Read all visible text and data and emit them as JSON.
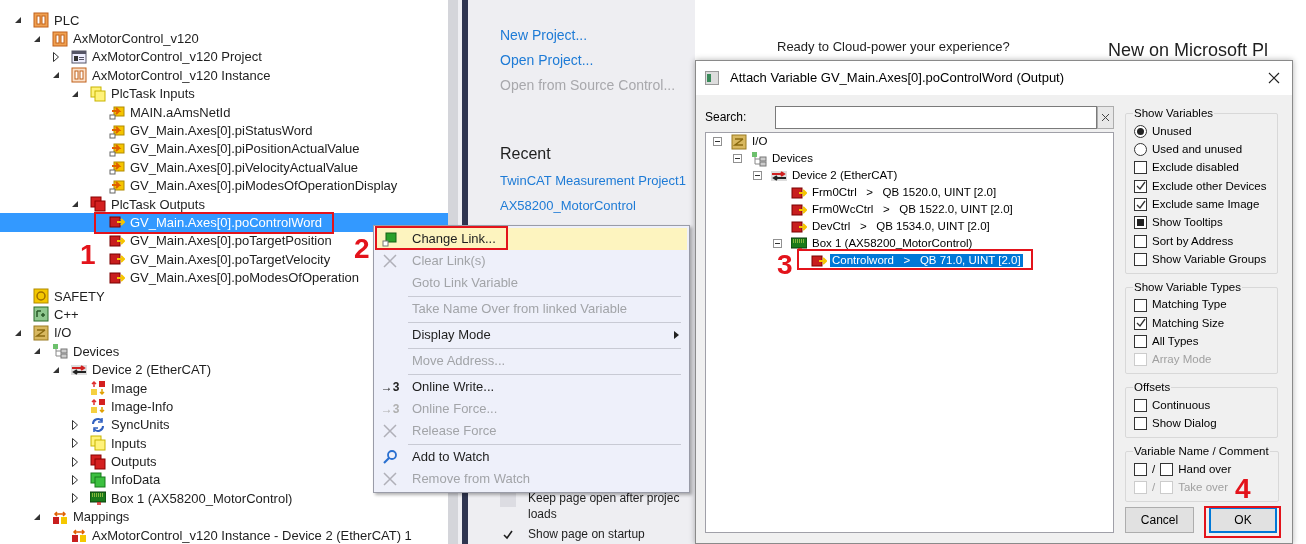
{
  "left_tree": {
    "items": [
      {
        "label": "PLC",
        "kind": "plc",
        "expanded": true,
        "selected": false,
        "children": [
          {
            "label": "AxMotorControl_v120",
            "kind": "plc",
            "expanded": true,
            "selected": false,
            "children": [
              {
                "label": "AxMotorControl_v120 Project",
                "kind": "project",
                "expanded": false,
                "selected": false
              },
              {
                "label": "AxMotorControl_v120 Instance",
                "kind": "instance",
                "expanded": true,
                "selected": false,
                "children": [
                  {
                    "label": "PlcTask Inputs",
                    "kind": "inputs",
                    "expanded": true,
                    "selected": false,
                    "children": [
                      {
                        "label": "MAIN.aAmsNetId",
                        "kind": "input-var",
                        "selected": false
                      },
                      {
                        "label": "GV_Main.Axes[0].piStatusWord",
                        "kind": "input-var",
                        "selected": false
                      },
                      {
                        "label": "GV_Main.Axes[0].piPositionActualValue",
                        "kind": "input-var",
                        "selected": false
                      },
                      {
                        "label": "GV_Main.Axes[0].piVelocityActualValue",
                        "kind": "input-var",
                        "selected": false
                      },
                      {
                        "label": "GV_Main.Axes[0].piModesOfOperationDisplay",
                        "kind": "input-var",
                        "selected": false
                      }
                    ]
                  },
                  {
                    "label": "PlcTask Outputs",
                    "kind": "outputs",
                    "expanded": true,
                    "selected": false,
                    "children": [
                      {
                        "label": "GV_Main.Axes[0].poControlWord",
                        "kind": "output-var",
                        "selected": true
                      },
                      {
                        "label": "GV_Main.Axes[0].poTargetPosition",
                        "kind": "output-var",
                        "selected": false
                      },
                      {
                        "label": "GV_Main.Axes[0].poTargetVelocity",
                        "kind": "output-var",
                        "selected": false
                      },
                      {
                        "label": "GV_Main.Axes[0].poModesOfOperation",
                        "kind": "output-var",
                        "selected": false
                      }
                    ]
                  }
                ]
              }
            ]
          }
        ]
      },
      {
        "label": "SAFETY",
        "kind": "safety",
        "selected": false
      },
      {
        "label": "C++",
        "kind": "cpp",
        "selected": false
      },
      {
        "label": "I/O",
        "kind": "io",
        "expanded": true,
        "selected": false,
        "children": [
          {
            "label": "Devices",
            "kind": "devices",
            "expanded": true,
            "selected": false,
            "children": [
              {
                "label": "Device 2 (EtherCAT)",
                "kind": "ethercat",
                "expanded": true,
                "selected": false,
                "children": [
                  {
                    "label": "Image",
                    "kind": "image",
                    "selected": false
                  },
                  {
                    "label": "Image-Info",
                    "kind": "image",
                    "selected": false
                  },
                  {
                    "label": "SyncUnits",
                    "kind": "sync",
                    "expanded": false,
                    "selected": false
                  },
                  {
                    "label": "Inputs",
                    "kind": "inputs",
                    "expanded": false,
                    "selected": false
                  },
                  {
                    "label": "Outputs",
                    "kind": "outputs",
                    "expanded": false,
                    "selected": false
                  },
                  {
                    "label": "InfoData",
                    "kind": "infodata",
                    "expanded": false,
                    "selected": false
                  },
                  {
                    "label": "Box 1 (AX58200_MotorControl)",
                    "kind": "box",
                    "expanded": false,
                    "selected": false
                  }
                ]
              }
            ]
          },
          {
            "label": "Mappings",
            "kind": "mappings",
            "expanded": true,
            "selected": false,
            "children": [
              {
                "label": "AxMotorControl_v120 Instance - Device 2 (EtherCAT) 1",
                "kind": "mapping",
                "selected": false
              }
            ]
          }
        ]
      }
    ]
  },
  "start_page": {
    "links": [
      {
        "text": "New Project...",
        "disabled": false
      },
      {
        "text": "Open Project...",
        "disabled": false
      },
      {
        "text": "Open from Source Control...",
        "disabled": true
      }
    ],
    "recent_heading": "Recent",
    "recent": [
      "TwinCAT Measurement Project1",
      "AX58200_MotorControl"
    ],
    "options": [
      {
        "label": "Keep page open after projec loads",
        "checked": false
      },
      {
        "label": "Show page on startup",
        "checked": true
      }
    ],
    "promo": "Ready to Cloud-power your experience?",
    "news_heading": "New on Microsoft Pl"
  },
  "context_menu": {
    "items": [
      {
        "kind": "link",
        "label": "Change Link...",
        "disabled": false,
        "selected": true,
        "submenu": false
      },
      {
        "kind": "clear",
        "label": "Clear Link(s)",
        "disabled": true,
        "selected": false,
        "submenu": false
      },
      {
        "kind": "plain",
        "label": "Goto Link Variable",
        "disabled": true,
        "selected": false,
        "submenu": false
      },
      {
        "kind": "separator"
      },
      {
        "kind": "plain",
        "label": "Take Name Over from linked Variable",
        "disabled": true,
        "selected": false,
        "submenu": false
      },
      {
        "kind": "separator"
      },
      {
        "kind": "plain",
        "label": "Display Mode",
        "disabled": false,
        "selected": false,
        "submenu": true
      },
      {
        "kind": "separator"
      },
      {
        "kind": "plain",
        "label": "Move Address...",
        "disabled": true,
        "selected": false,
        "submenu": false
      },
      {
        "kind": "separator"
      },
      {
        "kind": "glyph",
        "glyph": "→3",
        "label": "Online Write...",
        "disabled": false,
        "selected": false,
        "submenu": false
      },
      {
        "kind": "glyph",
        "glyph": "→3",
        "label": "Online Force...",
        "disabled": true,
        "selected": false,
        "submenu": false
      },
      {
        "kind": "clear",
        "label": "Release Force",
        "disabled": true,
        "selected": false,
        "submenu": false
      },
      {
        "kind": "separator"
      },
      {
        "kind": "watch",
        "label": "Add to Watch",
        "disabled": false,
        "selected": false,
        "submenu": false
      },
      {
        "kind": "clear",
        "label": "Remove from Watch",
        "disabled": true,
        "selected": false,
        "submenu": false
      }
    ]
  },
  "dialog": {
    "title": "Attach Variable GV_Main.Axes[0].poControlWord (Output)",
    "search_label": "Search:",
    "tree": [
      {
        "label": "I/O",
        "kind": "io",
        "expanded": true,
        "selected": false,
        "children": [
          {
            "label": "Devices",
            "kind": "devices",
            "expanded": true,
            "selected": false,
            "children": [
              {
                "label": "Device 2 (EtherCAT)",
                "kind": "ethercat",
                "expanded": true,
                "selected": false,
                "children": [
                  {
                    "label": "Frm0Ctrl   >   QB 1520.0, UINT [2.0]",
                    "kind": "output-var",
                    "selected": false
                  },
                  {
                    "label": "Frm0WcCtrl   >   QB 1522.0, UINT [2.0]",
                    "kind": "output-var",
                    "selected": false
                  },
                  {
                    "label": "DevCtrl   >   QB 1534.0, UINT [2.0]",
                    "kind": "output-var",
                    "selected": false
                  },
                  {
                    "label": "Box 1 (AX58200_MotorControl)",
                    "kind": "box",
                    "expanded": true,
                    "selected": false,
                    "children": [
                      {
                        "label": "Controlword   >   QB 71.0, UINT [2.0]",
                        "kind": "output-var",
                        "selected": true
                      }
                    ]
                  }
                ]
              }
            ]
          }
        ]
      }
    ],
    "groups": [
      {
        "title": "Show Variables",
        "options": [
          {
            "kind": "radio",
            "label": "Unused",
            "checked": true,
            "disabled": false
          },
          {
            "kind": "radio",
            "label": "Used and unused",
            "checked": false,
            "disabled": false
          },
          {
            "kind": "checkbox",
            "label": "Exclude disabled",
            "checked": false,
            "disabled": false
          },
          {
            "kind": "checkbox",
            "label": "Exclude other Devices",
            "checked": true,
            "disabled": false
          },
          {
            "kind": "checkbox",
            "label": "Exclude same Image",
            "checked": true,
            "disabled": false
          },
          {
            "kind": "tristate",
            "label": "Show Tooltips",
            "checked": true,
            "disabled": false
          },
          {
            "kind": "checkbox",
            "label": "Sort by Address",
            "checked": false,
            "disabled": false
          },
          {
            "kind": "checkbox",
            "label": "Show Variable Groups",
            "checked": false,
            "disabled": false
          }
        ]
      },
      {
        "title": "Show Variable Types",
        "options": [
          {
            "kind": "checkbox",
            "label": "Matching Type",
            "checked": false,
            "disabled": false
          },
          {
            "kind": "checkbox",
            "label": "Matching Size",
            "checked": true,
            "disabled": false
          },
          {
            "kind": "checkbox",
            "label": "All Types",
            "checked": false,
            "disabled": false
          },
          {
            "kind": "checkbox",
            "label": "Array Mode",
            "checked": false,
            "disabled": true
          }
        ]
      },
      {
        "title": "Offsets",
        "options": [
          {
            "kind": "checkbox",
            "label": "Continuous",
            "checked": false,
            "disabled": false
          },
          {
            "kind": "checkbox",
            "label": "Show Dialog",
            "checked": false,
            "disabled": false
          }
        ]
      },
      {
        "title": "Variable Name / Comment",
        "options": [
          {
            "kind": "pair",
            "separator": "/",
            "label": "Hand over",
            "checked": false,
            "disabled": false
          },
          {
            "kind": "pair",
            "separator": "/",
            "label": "Take over",
            "checked": false,
            "disabled": true
          }
        ]
      }
    ],
    "buttons": [
      {
        "label": "Cancel",
        "default": false
      },
      {
        "label": "OK",
        "default": true
      }
    ]
  },
  "annotations": [
    {
      "number": "1"
    },
    {
      "number": "2"
    },
    {
      "number": "3"
    },
    {
      "number": "4"
    }
  ]
}
